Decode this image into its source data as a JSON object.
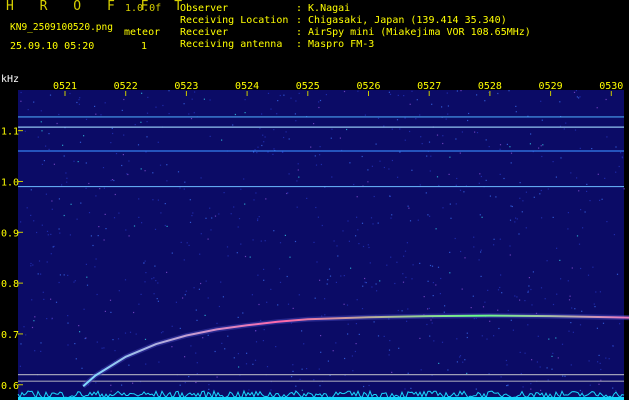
{
  "header": {
    "logo": "H R O F F T",
    "version": "1.0.0f",
    "filename": "KN9_2509100520.png",
    "datetime": "25.09.10 05:20",
    "meteor_label": "meteor",
    "meteor_count": "1",
    "info": [
      {
        "label": "Observer",
        "value": ": K.Nagai"
      },
      {
        "label": "Receiving Location",
        "value": ": Chigasaki, Japan (139.414 35.340)"
      },
      {
        "label": "Receiver",
        "value": ": AirSpy mini (Miakejima VOR 108.65MHz)"
      },
      {
        "label": "Receiving antenna",
        "value": ": Maspro FM-3"
      }
    ]
  },
  "chart_data": {
    "type": "heatmap",
    "ylabel": "kHz",
    "time_labels": [
      "0521",
      "0522",
      "0523",
      "0524",
      "0525",
      "0526",
      "0527",
      "0528",
      "0529",
      "0530"
    ],
    "y_ticks": [
      "1.1",
      "1.0",
      "0.9",
      "0.8",
      "0.7",
      "0.6"
    ],
    "ylim": [
      0.57,
      1.18
    ],
    "horizontal_lines": [
      {
        "freq": 1.127,
        "color": "#4fb0ff"
      },
      {
        "freq": 1.107,
        "color": "#9fd8ff"
      },
      {
        "freq": 1.06,
        "color": "#3a8cff"
      },
      {
        "freq": 0.99,
        "color": "#6ab8ff"
      },
      {
        "freq": 0.62,
        "color": "#b0b0c0"
      },
      {
        "freq": 0.607,
        "color": "#b0b0c0"
      }
    ],
    "meteor_trace": [
      {
        "t": 0.3,
        "f": 0.597
      },
      {
        "t": 0.5,
        "f": 0.618
      },
      {
        "t": 1.0,
        "f": 0.655
      },
      {
        "t": 1.5,
        "f": 0.68
      },
      {
        "t": 2.0,
        "f": 0.697
      },
      {
        "t": 2.5,
        "f": 0.709
      },
      {
        "t": 3.0,
        "f": 0.717
      },
      {
        "t": 3.5,
        "f": 0.724
      },
      {
        "t": 4.0,
        "f": 0.729
      },
      {
        "t": 5.0,
        "f": 0.733
      },
      {
        "t": 6.0,
        "f": 0.735
      },
      {
        "t": 7.0,
        "f": 0.736
      },
      {
        "t": 8.0,
        "f": 0.735
      },
      {
        "t": 9.0,
        "f": 0.733
      },
      {
        "t": 9.6,
        "f": 0.731
      }
    ],
    "colors": {
      "background": "#0b0b66",
      "tick_label": "#ffff00",
      "axis_label": "#ffffff",
      "baseline_noise": "#19d8ff"
    }
  }
}
